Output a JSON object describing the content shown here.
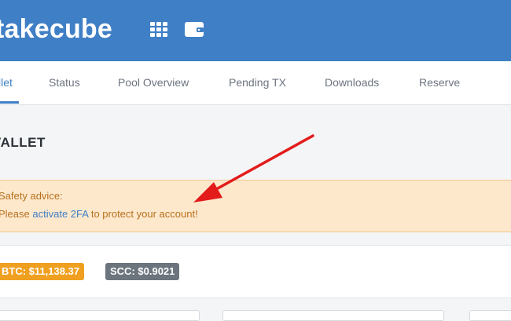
{
  "header": {
    "brand": "takecube",
    "icons": [
      "grid-icon",
      "wallet-icon"
    ]
  },
  "nav": {
    "tabs": [
      {
        "label": "llet",
        "active": true
      },
      {
        "label": "Status"
      },
      {
        "label": "Pool Overview"
      },
      {
        "label": "Pending TX"
      },
      {
        "label": "Downloads"
      },
      {
        "label": "Reserve"
      }
    ]
  },
  "page": {
    "title": "VALLET"
  },
  "alert": {
    "title": "Safety advice:",
    "text_before": "Please",
    "link": "activate 2FA",
    "text_after": "to protect your account!"
  },
  "prices": {
    "btc": "BTC: $11,138.37",
    "scc": "SCC: $0.9021"
  },
  "colors": {
    "brand": "#3f7fc6",
    "annotation": "#e31b1b",
    "btc_badge": "#f0a020",
    "scc_badge": "#6c757d"
  }
}
